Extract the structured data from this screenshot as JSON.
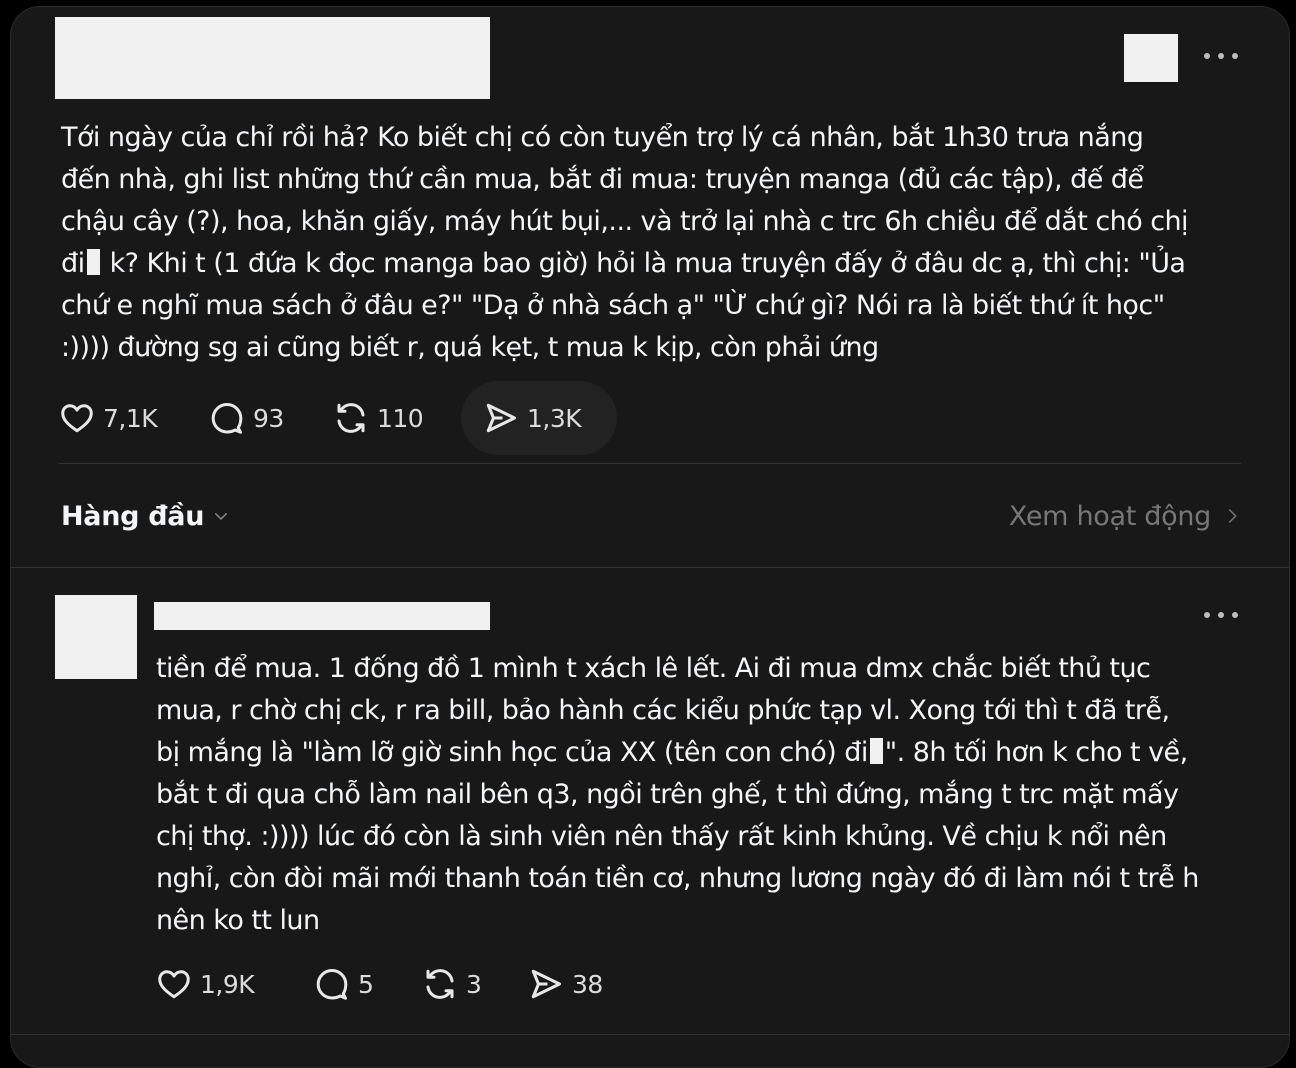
{
  "post": {
    "text_lines": [
      "Tới ngày của chỉ rồi hả? Ko biết chị có còn tuyển trợ lý cá nhân, bắt 1h30 trưa nắng",
      "đến nhà, ghi list những thứ cần mua, bắt đi mua: truyện manga (đủ các tập), đế để",
      "chậu cây (?), hoa, khăn giấy, máy hút bụi,... và trở lại nhà c trc 6h chiều để dắt chó chị",
      "đi",
      " k? Khi t (1 đứa k đọc manga bao giờ) hỏi là mua truyện đấy ở đâu dc ạ, thì chị: \"Ủa",
      "chứ e nghĩ mua sách ở đâu e?\" \"Dạ ở nhà sách ạ\" \"Ừ chứ gì? Nói ra là biết thứ ít học\"",
      ":)))) đường sg ai cũng biết r, quá kẹt, t mua k kịp, còn phải ứng"
    ],
    "likes": "7,1K",
    "comments": "93",
    "reposts": "110",
    "shares": "1,3K"
  },
  "sort": {
    "label": "Hàng đầu",
    "activity_label": "Xem hoạt động"
  },
  "reply": {
    "text_lines": [
      "tiền để mua. 1 đống đồ 1 mình t xách lê lết. Ai đi mua dmx chắc biết thủ tục",
      "mua, r chờ chị ck, r ra bill, bảo hành các kiểu phức tạp vl. Xong tới thì t đã trễ,",
      "bị mắng là \"làm lỡ giờ sinh học của XX (tên con chó) đi",
      "\". 8h tối hơn k cho t về,",
      "bắt t đi qua chỗ làm nail bên q3, ngồi trên ghế, t thì đứng, mắng t trc mặt mấy",
      "chị thợ. :)))) lúc đó còn là sinh viên nên thấy rất kinh khủng. Về chịu k nổi nên",
      "nghỉ, còn đòi mãi mới thanh toán tiền cơ, nhưng lương ngày đó đi làm nói t trễ h",
      "nên ko tt lun"
    ],
    "likes": "1,9K",
    "comments": "5",
    "reposts": "3",
    "shares": "38"
  },
  "icons": {
    "like": "heart-icon",
    "comment": "comment-bubble-icon",
    "repost": "repost-icon",
    "share": "send-icon",
    "more": "more-dots-icon",
    "chevron": "chevron-down-icon",
    "arrow": "chevron-right-icon"
  },
  "colors": {
    "background": "#181818",
    "text": "#f3f5f7",
    "muted": "#777777",
    "redaction": "#f1f1f1"
  }
}
